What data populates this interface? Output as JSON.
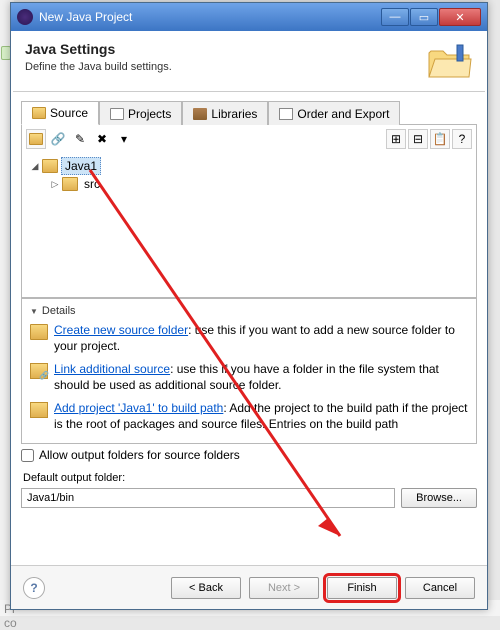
{
  "window": {
    "title": "New Java Project"
  },
  "header": {
    "title": "Java Settings",
    "subtitle": "Define the Java build settings."
  },
  "tabs": {
    "source": "Source",
    "projects": "Projects",
    "libraries": "Libraries",
    "order": "Order and Export"
  },
  "tree": {
    "project": "Java1",
    "src": "src"
  },
  "details": {
    "heading": "Details",
    "item1_link": "Create new source folder",
    "item1_rest": ": use this if you want to add a new source folder to your project.",
    "item2_link": "Link additional source",
    "item2_rest": ": use this if you have a folder in the file system that should be used as additional source folder.",
    "item3_link": "Add project 'Java1' to build path",
    "item3_rest": ": Add the project to the build path if the project is the root of packages and source files. Entries on the build path"
  },
  "allow_label": "Allow output folders for source folders",
  "output": {
    "label": "Default output folder:",
    "value": "Java1/bin",
    "browse": "Browse..."
  },
  "buttons": {
    "back": "< Back",
    "next": "Next >",
    "finish": "Finish",
    "cancel": "Cancel"
  },
  "bg": {
    "pr": "Pr",
    "co": "co"
  }
}
